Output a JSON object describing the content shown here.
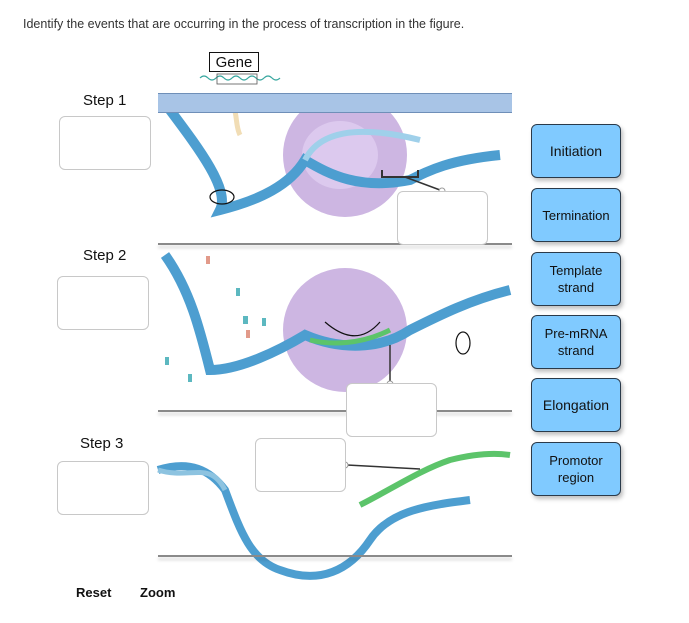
{
  "question": "Identify the events that are occurring in the process of transcription in the figure.",
  "figure": {
    "gene_label": "Gene",
    "steps": [
      {
        "label": "Step 1"
      },
      {
        "label": "Step 2"
      },
      {
        "label": "Step 3"
      }
    ]
  },
  "answer_tiles": [
    {
      "label": "Initiation"
    },
    {
      "label": "Termination"
    },
    {
      "label": "Template strand"
    },
    {
      "label": "Pre-mRNA strand"
    },
    {
      "label": "Elongation"
    },
    {
      "label": "Promotor region"
    }
  ],
  "tile_color": "#80caff",
  "controls": {
    "reset_label": "Reset",
    "zoom_label": "Zoom"
  }
}
